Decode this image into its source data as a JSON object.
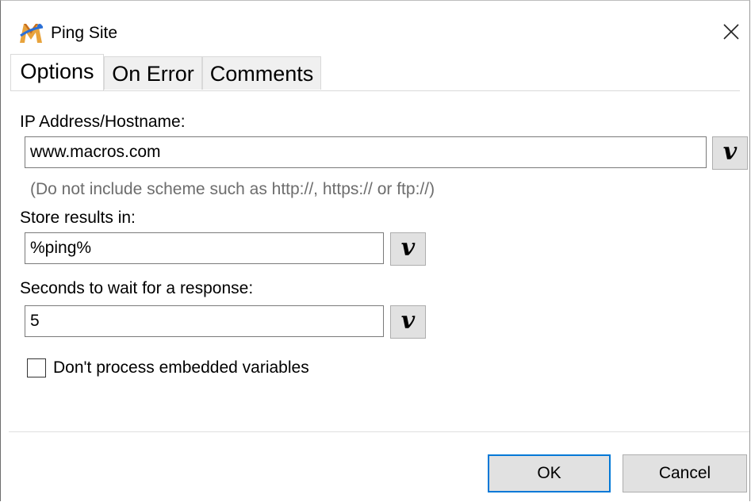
{
  "window": {
    "title": "Ping Site"
  },
  "tabs": [
    {
      "label": "Options",
      "active": true
    },
    {
      "label": "On Error",
      "active": false
    },
    {
      "label": "Comments",
      "active": false
    }
  ],
  "form": {
    "host_label": "IP Address/Hostname:",
    "host_value": "www.macros.com",
    "host_hint": "(Do not include scheme such as http://, https:// or ftp://)",
    "store_label": "Store results in:",
    "store_value": "%ping%",
    "wait_label": "Seconds to wait for a response:",
    "wait_value": "5",
    "variable_button_label": "v",
    "embedded_label": "Don't process embedded variables",
    "embedded_checked": false
  },
  "buttons": {
    "ok": "OK",
    "cancel": "Cancel"
  },
  "colors": {
    "accent": "#0078d7",
    "button_face": "#e1e1e1",
    "hint_text": "#6d6d6d"
  }
}
